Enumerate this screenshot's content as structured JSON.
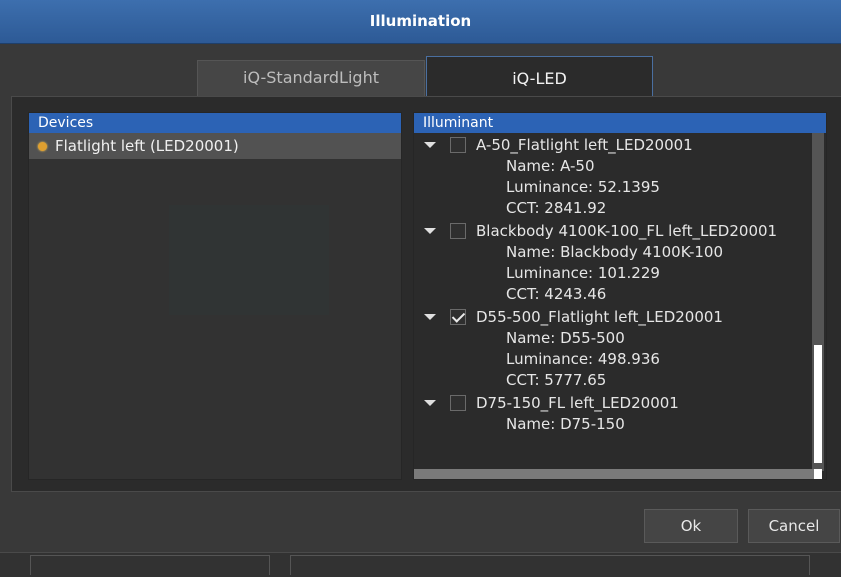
{
  "window": {
    "title": "Illumination"
  },
  "tabs": [
    {
      "label": "iQ-StandardLight",
      "active": false
    },
    {
      "label": "iQ-LED",
      "active": true
    }
  ],
  "devices": {
    "header": "Devices",
    "items": [
      {
        "label": "Flatlight left (LED20001)",
        "status_color": "#e0a030"
      }
    ]
  },
  "illuminant": {
    "header": "Illuminant",
    "items": [
      {
        "title": "A-50_Flatlight left_LED20001",
        "checked": false,
        "name": "Name: A-50",
        "luminance": "Luminance: 52.1395",
        "cct": "CCT: 2841.92"
      },
      {
        "title": "Blackbody 4100K-100_FL left_LED20001",
        "checked": false,
        "name": "Name: Blackbody 4100K-100",
        "luminance": "Luminance: 101.229",
        "cct": "CCT: 4243.46"
      },
      {
        "title": "D55-500_Flatlight left_LED20001",
        "checked": true,
        "name": "Name: D55-500",
        "luminance": "Luminance: 498.936",
        "cct": "CCT: 5777.65"
      },
      {
        "title": "D75-150_FL left_LED20001",
        "checked": false,
        "name": "Name: D75-150"
      }
    ]
  },
  "buttons": {
    "ok": "Ok",
    "cancel": "Cancel"
  },
  "colors": {
    "accent": "#2c63b5",
    "titlebar": "#3d6fae"
  }
}
